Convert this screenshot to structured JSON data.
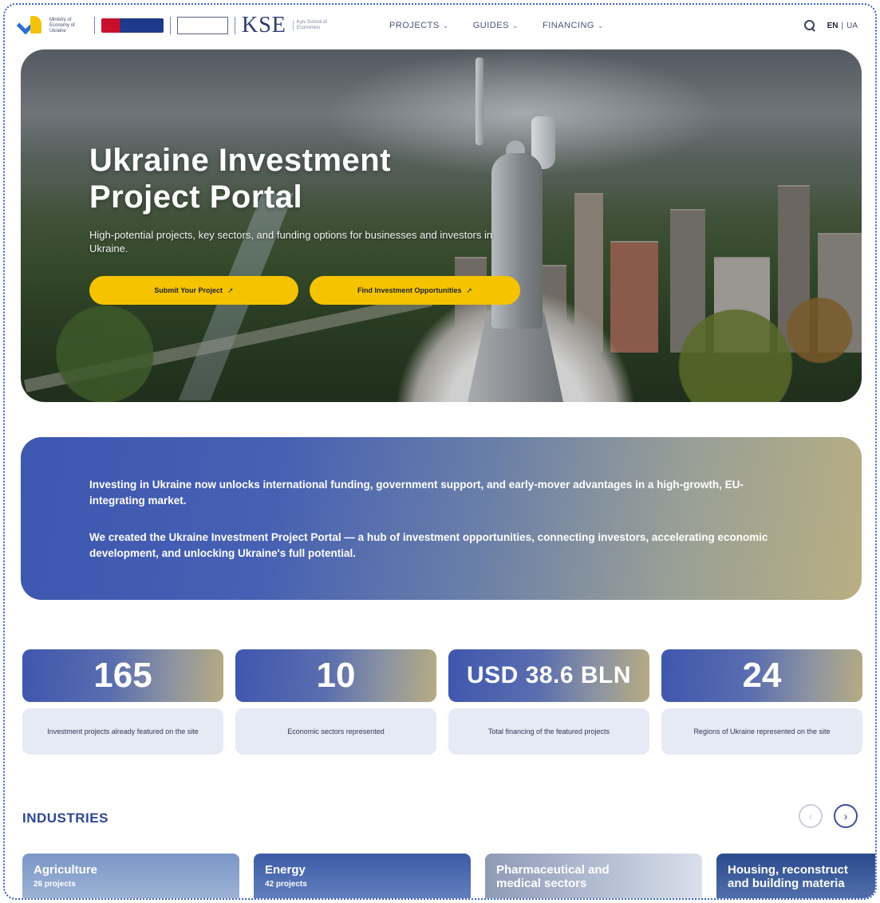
{
  "header": {
    "logos": {
      "ministry_text": "Ministry of Economy of Ukraine",
      "kse": "KSE",
      "kse_sub": "Kyiv School of Economics"
    },
    "nav": [
      {
        "label": "PROJECTS"
      },
      {
        "label": "GUIDES"
      },
      {
        "label": "FINANCING"
      }
    ],
    "lang_active": "EN",
    "lang_sep": "|",
    "lang_other": "UA"
  },
  "hero": {
    "title_line1": "Ukraine Investment",
    "title_line2": "Project Portal",
    "subtitle": "High-potential projects, key sectors, and funding options for businesses and investors in Ukraine.",
    "btn_submit": "Submit Your Project",
    "btn_find": "Find Investment Opportunities"
  },
  "intro": {
    "p1": "Investing in Ukraine now unlocks international funding, government support, and early-mover advantages in a high-growth, EU-integrating market.",
    "p2": "We created the Ukraine Investment Project Portal — a hub of investment opportunities, connecting investors, accelerating economic development, and unlocking Ukraine's full potential."
  },
  "stats": [
    {
      "value": "165",
      "label": "Investment projects already featured on the site"
    },
    {
      "value": "10",
      "label": "Economic sectors represented"
    },
    {
      "value": "USD 38.6 BLN",
      "label": "Total financing of the featured projects"
    },
    {
      "value": "24",
      "label": "Regions of Ukraine represented on the site"
    }
  ],
  "industries": {
    "title": "INDUSTRIES",
    "prev": "‹",
    "next": "›",
    "cards": [
      {
        "title": "Agriculture",
        "count": "26 projects"
      },
      {
        "title": "Energy",
        "count": "42 projects"
      },
      {
        "title": "Pharmaceutical and",
        "title2": "medical sectors"
      },
      {
        "title": "Housing, reconstruct",
        "title2": "and building materia"
      }
    ]
  },
  "colors": {
    "accent_yellow": "#f6c300",
    "brand_blue": "#2e4697",
    "stat_label_bg": "#e6eaf5"
  }
}
